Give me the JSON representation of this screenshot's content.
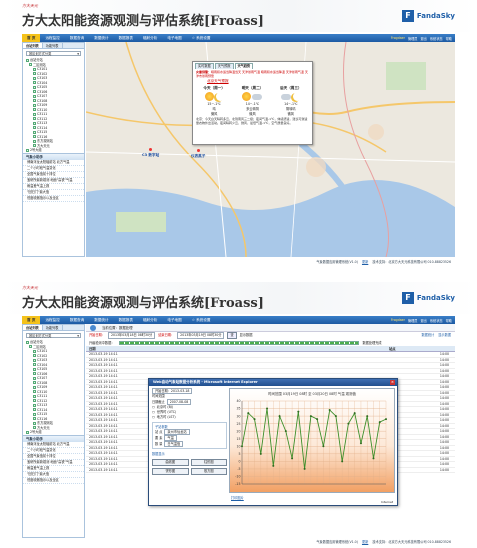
{
  "app": {
    "subtitle": "方大天元",
    "title": "方大太阳能资源观测与评估系统[Froass]",
    "logo_text": "FandaSky",
    "logo_mark": "F"
  },
  "menu": {
    "items": [
      "首 页",
      "远程监控",
      "数据查询",
      "数据统计",
      "数据报表",
      "辐射分析",
      "电子地图",
      "☆ 系统设置"
    ],
    "active_index": 0,
    "right": [
      "Frogdaer",
      "管理员",
      "退出",
      "系统状态",
      "帮助"
    ]
  },
  "sidebar": {
    "tabs": [
      "台站列表",
      "功能列表"
    ],
    "combo": "按区划方式分类",
    "root": "台站分站",
    "group": "二区测站",
    "stations": [
      "C3101",
      "C3102",
      "C3103",
      "C3104",
      "C3105",
      "C3106",
      "C3107",
      "C3108",
      "C3109",
      "C3110",
      "C3111",
      "C3112",
      "C3113",
      "C3114",
      "C3115",
      "C3116"
    ],
    "extra": [
      "东方观测站",
      "方大天元"
    ],
    "tail": "2号大组",
    "panel_title": "气象小助手",
    "panel_items": [
      "博南浮龙太阳辐射站 北方气温",
      "二个小时段气温变化",
      "全国气象值前十排位",
      "宝研所最新观测 地面\"高铁\"气温",
      "雨温差气温上报",
      "\"回归门\"最大值",
      "低度收缩指示以及全区"
    ]
  },
  "map": {
    "popup": {
      "tabs": [
        "实时数据",
        "天气预报",
        "天气趋势"
      ],
      "active_tab": 2,
      "alert_label": "灾害预警：",
      "alert_text": "暗雨积水适当降温当天 天津暴雨气温 暗雨积水适当降温 天津暴雨气温 天津市暴雨预警",
      "alert_link": "北京天气预报",
      "days": [
        {
          "name": "今天（周一）",
          "temp": "15~-1℃",
          "desc": "晴",
          "wind": "微风"
        },
        {
          "name": "明天（周二）",
          "temp": "14~-1℃",
          "desc": "多云转阴",
          "wind": "微风"
        },
        {
          "name": "后天（周三）",
          "temp": "14~-1℃",
          "desc": "阴转晴",
          "wind": "微风"
        }
      ],
      "note": "北京：今天白天晴转多云，北到南风三二级；夜间气温-1℃，体感舒适，建议可穿适量衣物外出活动。夜间晴转少云，微风，最低气温-1℃，空气质量良好。"
    },
    "pins": [
      "C3 数字站",
      "仪表蒸子"
    ]
  },
  "footer": {
    "system": "气象数据应用管理系统(V1.0)",
    "link": "更新",
    "support": "技术支持：北京方大天元科技有限公司 010-88823526"
  },
  "screen2": {
    "breadcrumb": "当前位置：数据处理",
    "filters": {
      "start_label": "开始日期：",
      "start_value": "2013年03月18日 08时30分",
      "end_label": "结束日期：",
      "end_value": "2013年03月19日 08时30分",
      "button": "查",
      "checkbox": "显示数据",
      "right": [
        "数据统计",
        "显示数据"
      ]
    },
    "progress_label": "升级检测中数据：",
    "progress_right": "数据处理完成",
    "table": {
      "headers": [
        "日期",
        "站点"
      ],
      "rows": [
        {
          "date": "2013-03-19 14:11",
          "val": "14:00"
        },
        {
          "date": "2013-03-19 14:11",
          "val": "14:00"
        },
        {
          "date": "2013-03-19 14:11",
          "val": "14:00"
        },
        {
          "date": "2013-03-19 14:11",
          "val": "14:00"
        },
        {
          "date": "2013-03-19 14:11",
          "val": "14:00"
        },
        {
          "date": "2013-03-19 14:11",
          "val": "14:00"
        },
        {
          "date": "2013-03-19 14:11",
          "val": "14:00"
        },
        {
          "date": "2013-03-19 14:11",
          "val": "14:00"
        },
        {
          "date": "2013-03-19 14:11",
          "val": "14:00"
        },
        {
          "date": "2013-03-19 14:11",
          "val": "14:00"
        },
        {
          "date": "2013-03-19 14:11",
          "val": "14:00"
        },
        {
          "date": "2013-03-19 14:11",
          "val": "14:00"
        },
        {
          "date": "2013-03-19 14:11",
          "val": "14:00"
        },
        {
          "date": "2013-03-19 14:11",
          "val": "14:00"
        },
        {
          "date": "2013-03-19 14:11",
          "val": "14:00"
        },
        {
          "date": "2013-03-19 14:11",
          "val": "14:00"
        },
        {
          "date": "2013-03-19 14:11",
          "val": "14:00"
        },
        {
          "date": "2013-03-19 14:11",
          "val": "14:00"
        },
        {
          "date": "2013-03-19 14:11",
          "val": "14:00"
        },
        {
          "date": "2013-03-19 14:11",
          "val": "14:00"
        },
        {
          "date": "2013-03-19 14:11",
          "val": "14:00"
        },
        {
          "date": "2013-03-19 14:11",
          "val": "14:00"
        }
      ]
    },
    "dialog": {
      "title": "Web自动气象站数据分析系统 - Microsoft Internet Explorer",
      "start": "开始日期：2013-03-18",
      "time_label": "时间范围",
      "date_label": "日期截止",
      "date_value": "2007-08-08",
      "radios": [
        "北京时 (BJ)",
        "世界时 (UTC)",
        "地方时 (LST)"
      ],
      "group_label": "子站参数",
      "station_label": "站 点",
      "station_value": "泉州市仙龙站",
      "element_label": "要 素",
      "element_value": "气温",
      "ytype_label": "数 量",
      "ytype_value": "日气温值",
      "buttons_label": "数据显示",
      "buttons": [
        "曲线图",
        "柱形图",
        "饼形图",
        "散方图"
      ],
      "download": "打印图片",
      "status": "Internet"
    }
  },
  "chart_data": {
    "type": "line",
    "title": "时间范围 03月19日 08时 至 03月20日 08时 气温 观测值",
    "ylim": [
      -15,
      40
    ],
    "yticks": [
      40,
      35,
      30,
      25,
      20,
      15,
      10,
      5,
      0,
      -5,
      -10,
      -15
    ],
    "x": [
      1,
      2,
      3,
      4,
      5,
      6,
      7,
      8,
      9,
      10,
      11,
      12,
      13,
      14,
      15,
      16,
      17,
      18,
      19,
      20,
      21,
      22,
      23,
      24
    ],
    "series": [
      {
        "values": [
          10,
          32,
          28,
          5,
          35,
          -3,
          30,
          20,
          2,
          33,
          -5,
          30,
          28,
          10,
          34,
          30,
          0,
          25,
          32,
          12,
          30,
          2,
          26,
          28
        ]
      }
    ],
    "colors": {
      "line": "#3d8f2a",
      "point": "#2d6b1f",
      "grid": "#e2b08a"
    }
  }
}
